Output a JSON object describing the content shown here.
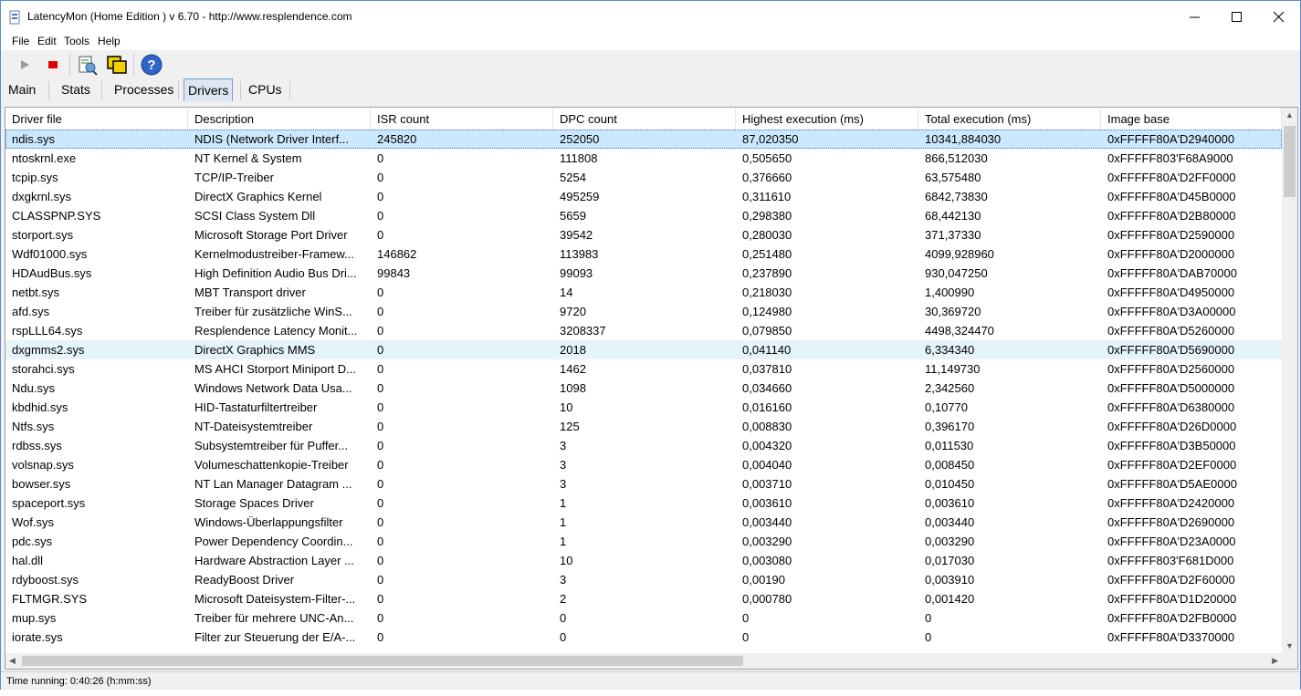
{
  "window": {
    "title": "LatencyMon  (Home Edition )  v 6.70 - http://www.resplendence.com"
  },
  "menu": [
    "File",
    "Edit",
    "Tools",
    "Help"
  ],
  "toolbar": {
    "buttons": [
      "play-icon",
      "stop-icon",
      "report-icon",
      "windows-icon",
      "help-icon"
    ]
  },
  "tabs": [
    "Main",
    "Stats",
    "Processes",
    "Drivers",
    "CPUs"
  ],
  "active_tab": "Drivers",
  "table": {
    "columns": [
      "Driver file",
      "Description",
      "ISR count",
      "DPC count",
      "Highest execution (ms)",
      "Total execution (ms)",
      "Image base"
    ],
    "rows": [
      [
        "ndis.sys",
        "NDIS (Network Driver Interf...",
        "245820",
        "252050",
        "87,020350",
        "10341,884030",
        "0xFFFFF80A'D2940000"
      ],
      [
        "ntoskrnl.exe",
        "NT Kernel & System",
        "0",
        "111808",
        "0,505650",
        "866,512030",
        "0xFFFFF803'F68A9000"
      ],
      [
        "tcpip.sys",
        "TCP/IP-Treiber",
        "0",
        "5254",
        "0,376660",
        "63,575480",
        "0xFFFFF80A'D2FF0000"
      ],
      [
        "dxgkrnl.sys",
        "DirectX Graphics Kernel",
        "0",
        "495259",
        "0,311610",
        "6842,73830",
        "0xFFFFF80A'D45B0000"
      ],
      [
        "CLASSPNP.SYS",
        "SCSI Class System Dll",
        "0",
        "5659",
        "0,298380",
        "68,442130",
        "0xFFFFF80A'D2B80000"
      ],
      [
        "storport.sys",
        "Microsoft Storage Port Driver",
        "0",
        "39542",
        "0,280030",
        "371,37330",
        "0xFFFFF80A'D2590000"
      ],
      [
        "Wdf01000.sys",
        "Kernelmodustreiber-Framew...",
        "146862",
        "113983",
        "0,251480",
        "4099,928960",
        "0xFFFFF80A'D2000000"
      ],
      [
        "HDAudBus.sys",
        "High Definition Audio Bus Dri...",
        "99843",
        "99093",
        "0,237890",
        "930,047250",
        "0xFFFFF80A'DAB70000"
      ],
      [
        "netbt.sys",
        "MBT Transport driver",
        "0",
        "14",
        "0,218030",
        "1,400990",
        "0xFFFFF80A'D4950000"
      ],
      [
        "afd.sys",
        "Treiber für zusätzliche WinS...",
        "0",
        "9720",
        "0,124980",
        "30,369720",
        "0xFFFFF80A'D3A00000"
      ],
      [
        "rspLLL64.sys",
        "Resplendence Latency Monit...",
        "0",
        "3208337",
        "0,079850",
        "4498,324470",
        "0xFFFFF80A'D5260000"
      ],
      [
        "dxgmms2.sys",
        "DirectX Graphics MMS",
        "0",
        "2018",
        "0,041140",
        "6,334340",
        "0xFFFFF80A'D5690000"
      ],
      [
        "storahci.sys",
        "MS AHCI Storport Miniport D...",
        "0",
        "1462",
        "0,037810",
        "11,149730",
        "0xFFFFF80A'D2560000"
      ],
      [
        "Ndu.sys",
        "Windows Network Data Usa...",
        "0",
        "1098",
        "0,034660",
        "2,342560",
        "0xFFFFF80A'D5000000"
      ],
      [
        "kbdhid.sys",
        "HID-Tastaturfiltertreiber",
        "0",
        "10",
        "0,016160",
        "0,10770",
        "0xFFFFF80A'D6380000"
      ],
      [
        "Ntfs.sys",
        "NT-Dateisystemtreiber",
        "0",
        "125",
        "0,008830",
        "0,396170",
        "0xFFFFF80A'D26D0000"
      ],
      [
        "rdbss.sys",
        "Subsystemtreiber für Puffer...",
        "0",
        "3",
        "0,004320",
        "0,011530",
        "0xFFFFF80A'D3B50000"
      ],
      [
        "volsnap.sys",
        "Volumeschattenkopie-Treiber",
        "0",
        "3",
        "0,004040",
        "0,008450",
        "0xFFFFF80A'D2EF0000"
      ],
      [
        "bowser.sys",
        "NT Lan Manager Datagram ...",
        "0",
        "3",
        "0,003710",
        "0,010450",
        "0xFFFFF80A'D5AE0000"
      ],
      [
        "spaceport.sys",
        "Storage Spaces Driver",
        "0",
        "1",
        "0,003610",
        "0,003610",
        "0xFFFFF80A'D2420000"
      ],
      [
        "Wof.sys",
        "Windows-Überlappungsfilter",
        "0",
        "1",
        "0,003440",
        "0,003440",
        "0xFFFFF80A'D2690000"
      ],
      [
        "pdc.sys",
        "Power Dependency Coordin...",
        "0",
        "1",
        "0,003290",
        "0,003290",
        "0xFFFFF80A'D23A0000"
      ],
      [
        "hal.dll",
        "Hardware Abstraction Layer ...",
        "0",
        "10",
        "0,003080",
        "0,017030",
        "0xFFFFF803'F681D000"
      ],
      [
        "rdyboost.sys",
        "ReadyBoost Driver",
        "0",
        "3",
        "0,00190",
        "0,003910",
        "0xFFFFF80A'D2F60000"
      ],
      [
        "FLTMGR.SYS",
        "Microsoft Dateisystem-Filter-...",
        "0",
        "2",
        "0,000780",
        "0,001420",
        "0xFFFFF80A'D1D20000"
      ],
      [
        "mup.sys",
        "Treiber für mehrere UNC-An...",
        "0",
        "0",
        "0",
        "0",
        "0xFFFFF80A'D2FB0000"
      ],
      [
        "iorate.sys",
        "Filter zur Steuerung der E/A-...",
        "0",
        "0",
        "0",
        "0",
        "0xFFFFF80A'D3370000"
      ]
    ],
    "selected_row": 0,
    "hover_row": 11
  },
  "status": "Time running: 0:40:26  (h:mm:ss)"
}
